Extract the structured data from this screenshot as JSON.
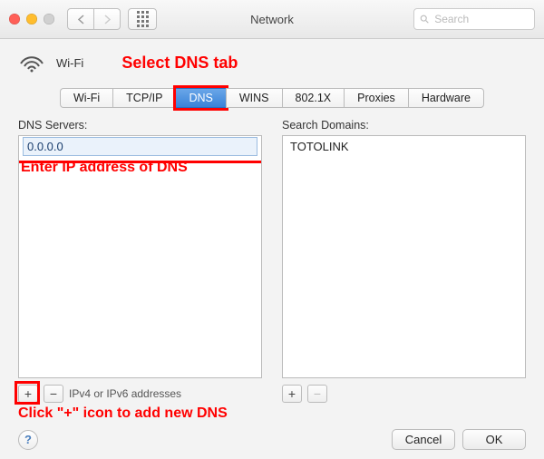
{
  "window": {
    "title": "Network"
  },
  "search": {
    "placeholder": "Search"
  },
  "connection": {
    "name": "Wi-Fi"
  },
  "annotations": {
    "select_tab": "Select DNS tab",
    "enter_ip": "Enter IP address of DNS",
    "click_plus": "Click \"+\" icon to add new DNS"
  },
  "tabs": [
    {
      "label": "Wi-Fi",
      "selected": false
    },
    {
      "label": "TCP/IP",
      "selected": false
    },
    {
      "label": "DNS",
      "selected": true
    },
    {
      "label": "WINS",
      "selected": false
    },
    {
      "label": "802.1X",
      "selected": false
    },
    {
      "label": "Proxies",
      "selected": false
    },
    {
      "label": "Hardware",
      "selected": false
    }
  ],
  "dns": {
    "label": "DNS Servers:",
    "input_value": "0.0.0.0",
    "footer_hint": "IPv4 or IPv6 addresses"
  },
  "search_domains": {
    "label": "Search Domains:",
    "items": [
      "TOTOLINK"
    ]
  },
  "buttons": {
    "help": "?",
    "cancel": "Cancel",
    "ok": "OK",
    "plus": "+",
    "minus": "−"
  }
}
